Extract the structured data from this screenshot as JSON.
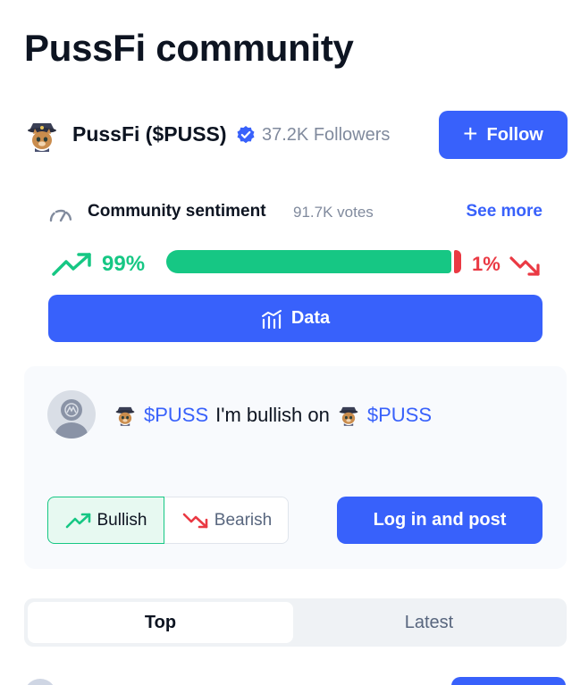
{
  "page": {
    "title": "PussFi community"
  },
  "coin": {
    "name": "PussFi ($PUSS)",
    "followers": "37.2K Followers",
    "follow_label": "Follow",
    "avatar_icon": "cat-pirate-icon",
    "verified_icon": "verified-badge-icon"
  },
  "sentiment": {
    "label": "Community sentiment",
    "votes": "91.7K votes",
    "see_more": "See more",
    "bullish_pct_text": "99%",
    "bearish_pct_text": "1%",
    "bullish_fraction": 0.99,
    "bearish_fraction": 0.01,
    "data_label": "Data"
  },
  "post": {
    "ticker_1": "$PUSS",
    "text": "I'm bullish on",
    "ticker_2": "$PUSS",
    "bullish_label": "Bullish",
    "bearish_label": "Bearish",
    "login_label": "Log in and post"
  },
  "tabs": [
    {
      "label": "Top",
      "active": true
    },
    {
      "label": "Latest",
      "active": false
    }
  ],
  "colors": {
    "accent": "#3861fb",
    "bullish": "#16c784",
    "bearish": "#ea3943"
  }
}
